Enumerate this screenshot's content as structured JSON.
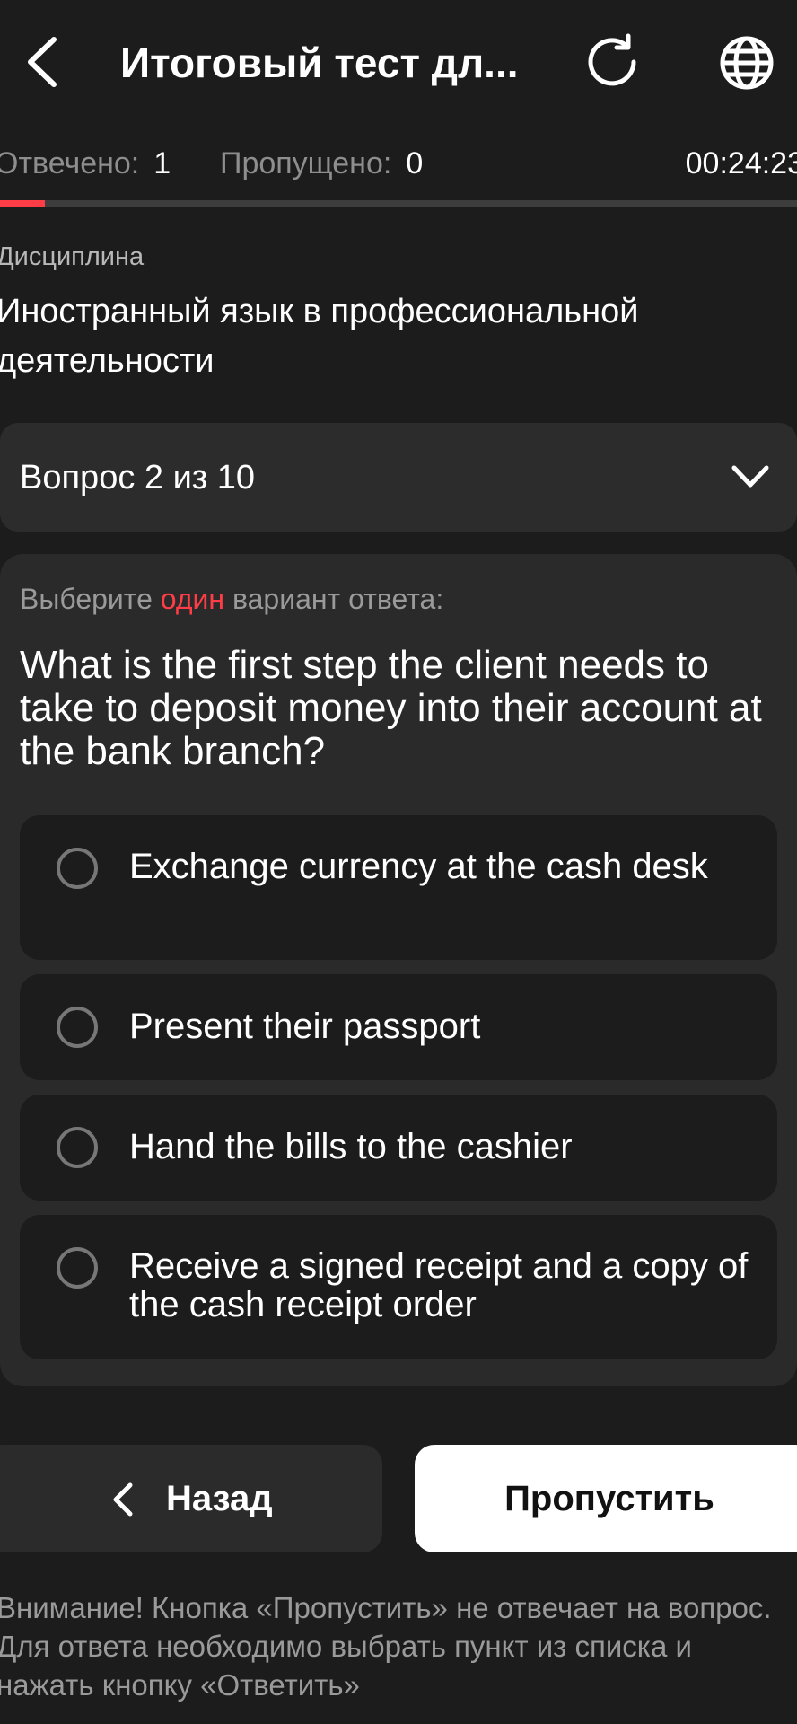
{
  "header": {
    "title": "Итоговый тест дл...",
    "back_icon": "chevron-left-icon",
    "reload_icon": "reload-icon",
    "language_icon": "globe-icon"
  },
  "stats": {
    "answered_label": "Отвечено:",
    "answered_value": "1",
    "skipped_label": "Пропущено:",
    "skipped_value": "0",
    "timer": "00:24:23",
    "progress_fraction": 0.056
  },
  "discipline": {
    "label": "Дисциплина",
    "name": "Иностранный язык в профессиональной деятельности"
  },
  "question_selector": {
    "label": "Вопрос 2 из 10",
    "chevron_icon": "chevron-down-icon"
  },
  "question": {
    "instruction_before": "Выберите ",
    "instruction_accent": "один",
    "instruction_after": " вариант ответа:",
    "text": "What is the first step the client needs to take to deposit money into their account at the bank branch?",
    "options": [
      {
        "label": "Exchange currency at the cash desk"
      },
      {
        "label": "Present their passport"
      },
      {
        "label": "Hand the bills to the cashier"
      },
      {
        "label": "Receive a signed receipt and a copy of the cash receipt order"
      }
    ]
  },
  "buttons": {
    "back_label": "Назад",
    "skip_label": "Пропустить"
  },
  "warning": "Внимание! Кнопка «Пропустить» не отвечает на вопрос. Для ответа необходимо выбрать пункт из списка и нажать кнопку «Ответить»",
  "colors": {
    "background": "#1c1c1c",
    "card": "#2a2a2a",
    "accent": "#ff3d47",
    "muted_text": "#9a9a9a"
  }
}
